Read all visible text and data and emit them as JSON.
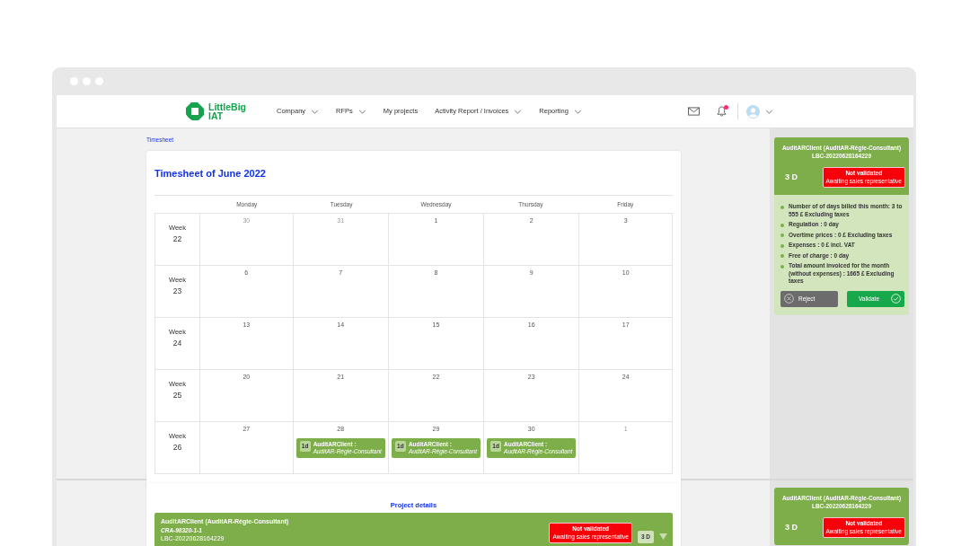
{
  "navbar": {
    "logo": "LittleBig IAT",
    "menu": [
      {
        "label": "Company",
        "dropdown": true
      },
      {
        "label": "RFPs",
        "dropdown": true
      },
      {
        "label": "My projects",
        "dropdown": false
      },
      {
        "label": "Activity Report / Invoices",
        "dropdown": true
      },
      {
        "label": "Reporting",
        "dropdown": true
      }
    ],
    "notifications_unread": true
  },
  "breadcrumb": "Timesheet",
  "timesheet": {
    "title": "Timesheet of June 2022",
    "weekdays": [
      "Monday",
      "Tuesday",
      "Wednesday",
      "Thursday",
      "Friday"
    ],
    "weeks": [
      {
        "label": "Week",
        "number": "22",
        "days": [
          {
            "date": "30",
            "outside_month": true
          },
          {
            "date": "31",
            "outside_month": true
          },
          {
            "date": "1",
            "outside_month": false
          },
          {
            "date": "2",
            "outside_month": false
          },
          {
            "date": "3",
            "outside_month": false
          }
        ]
      },
      {
        "label": "Week",
        "number": "23",
        "days": [
          {
            "date": "6",
            "outside_month": false
          },
          {
            "date": "7",
            "outside_month": false
          },
          {
            "date": "8",
            "outside_month": false
          },
          {
            "date": "9",
            "outside_month": false
          },
          {
            "date": "10",
            "outside_month": false
          }
        ]
      },
      {
        "label": "Week",
        "number": "24",
        "days": [
          {
            "date": "13",
            "outside_month": false
          },
          {
            "date": "14",
            "outside_month": false
          },
          {
            "date": "15",
            "outside_month": false
          },
          {
            "date": "16",
            "outside_month": false
          },
          {
            "date": "17",
            "outside_month": false
          }
        ]
      },
      {
        "label": "Week",
        "number": "25",
        "days": [
          {
            "date": "20",
            "outside_month": false
          },
          {
            "date": "21",
            "outside_month": false
          },
          {
            "date": "22",
            "outside_month": false
          },
          {
            "date": "23",
            "outside_month": false
          },
          {
            "date": "24",
            "outside_month": false
          }
        ]
      },
      {
        "label": "Week",
        "number": "26",
        "days": [
          {
            "date": "27",
            "outside_month": false
          },
          {
            "date": "28",
            "outside_month": false,
            "events": [
              {
                "duration": "1d",
                "client": "AuditARClient :",
                "project": "AuditAR-Régie-Consultant"
              }
            ]
          },
          {
            "date": "29",
            "outside_month": false,
            "events": [
              {
                "duration": "1d",
                "client": "AuditARClient :",
                "project": "AuditAR-Régie-Consultant"
              }
            ]
          },
          {
            "date": "30",
            "outside_month": false,
            "events": [
              {
                "duration": "1d",
                "client": "AuditARClient :",
                "project": "AuditAR-Régie-Consultant"
              }
            ]
          },
          {
            "date": "1",
            "outside_month": true
          }
        ]
      }
    ]
  },
  "validation_panels": [
    {
      "client": "AuditARClient (AuditAR-Régie-Consultant)",
      "reference": "LBC-20220628164229",
      "days": "3 D",
      "status": {
        "label": "Not validated",
        "sublabel": "Awaiting sales representative"
      },
      "details": [
        "Number of of days billed this month: 3 to 555 £ Excluding taxes",
        "Regulation : 0 day",
        "Overtime prices : 0 £ Excluding taxes",
        "Expenses : 0 £ incl. VAT",
        "Free of charge : 0 day",
        "Total amount invoiced for the month (without expenses) : 1665 £ Excluding taxes"
      ],
      "actions": [
        {
          "kind": "reject",
          "label": "Reject"
        },
        {
          "kind": "validate",
          "label": "Validate"
        }
      ]
    },
    {
      "client": "AuditARClient (AuditAR-Régie-Consultant)",
      "reference": "LBC-20220628164229",
      "days": "3 D",
      "status": {
        "label": "Not validated",
        "sublabel": "Awaiting sales representative"
      }
    }
  ],
  "project_details": {
    "title": "Project details",
    "projects": [
      {
        "client": "AuditARClient (AuditAR-Régie-Consultant)",
        "code": "CRA-98320-1-1",
        "reference": "LBC-20220628164229",
        "status": {
          "label": "Not validated",
          "sublabel": "Awaiting sales representative"
        },
        "days": "3 D"
      }
    ]
  }
}
